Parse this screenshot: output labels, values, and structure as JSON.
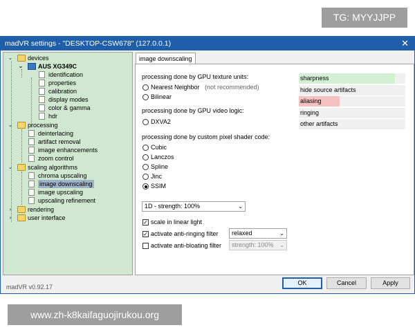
{
  "watermarks": {
    "top": "TG: MYYJJPP",
    "bottom": "www.zh-k8kaifaguojirukou.org"
  },
  "window": {
    "title": "madVR settings - \"DESKTOP-CSW678\" (127.0.0.1)",
    "close": "✕"
  },
  "tree": {
    "devices": "devices",
    "monitor": "AUS XG349C",
    "identification": "identification",
    "properties": "properties",
    "calibration": "calibration",
    "display_modes": "display modes",
    "color_gamma": "color & gamma",
    "hdr": "hdr",
    "processing": "processing",
    "deinterlacing": "deinterlacing",
    "artifact_removal": "artifact removal",
    "image_enhancements": "image enhancements",
    "zoom_control": "zoom control",
    "scaling_algorithms": "scaling algorithms",
    "chroma_upscaling": "chroma upscaling",
    "image_downscaling": "image downscaling",
    "image_upscaling": "image upscaling",
    "upscaling_refinement": "upscaling refinement",
    "rendering": "rendering",
    "user_interface": "user interface",
    "selected": "image downscaling"
  },
  "tab": {
    "label": "image downscaling"
  },
  "panel": {
    "gpu_texture_heading": "processing done by GPU texture units:",
    "nearest_neighbor": "Nearest Neighbor",
    "not_recommended": "(not recommended)",
    "bilinear": "Bilinear",
    "gpu_video_heading": "processing done by GPU video logic:",
    "dxva2": "DXVA2",
    "pixel_shader_heading": "processing done by custom pixel shader code:",
    "cubic": "Cubic",
    "lanczos": "Lanczos",
    "spline": "Spline",
    "jinc": "Jinc",
    "ssim": "SSIM",
    "selected_algorithm": "SSIM",
    "strength_value": "1D - strength: 100%",
    "scale_linear_light": {
      "label": "scale in linear light",
      "checked": true
    },
    "anti_ringing": {
      "label": "activate anti-ringing filter",
      "checked": true,
      "value": "relaxed"
    },
    "anti_bloating": {
      "label": "activate anti-bloating filter",
      "checked": false,
      "value": "strength: 100%"
    }
  },
  "quality_list": [
    {
      "label": "sharpness",
      "color": "#d4f0d4",
      "fill": 0.9
    },
    {
      "label": "hide source artifacts",
      "color": "#f0f0f0",
      "fill": 0
    },
    {
      "label": "aliasing",
      "color": "#f4c0c0",
      "fill": 0.38
    },
    {
      "label": "ringing",
      "color": "#f0f0f0",
      "fill": 0
    },
    {
      "label": "other artifacts",
      "color": "#f0f0f0",
      "fill": 0
    }
  ],
  "footer": {
    "version": "madVR v0.92.17",
    "ok": "OK",
    "cancel": "Cancel",
    "apply": "Apply"
  }
}
